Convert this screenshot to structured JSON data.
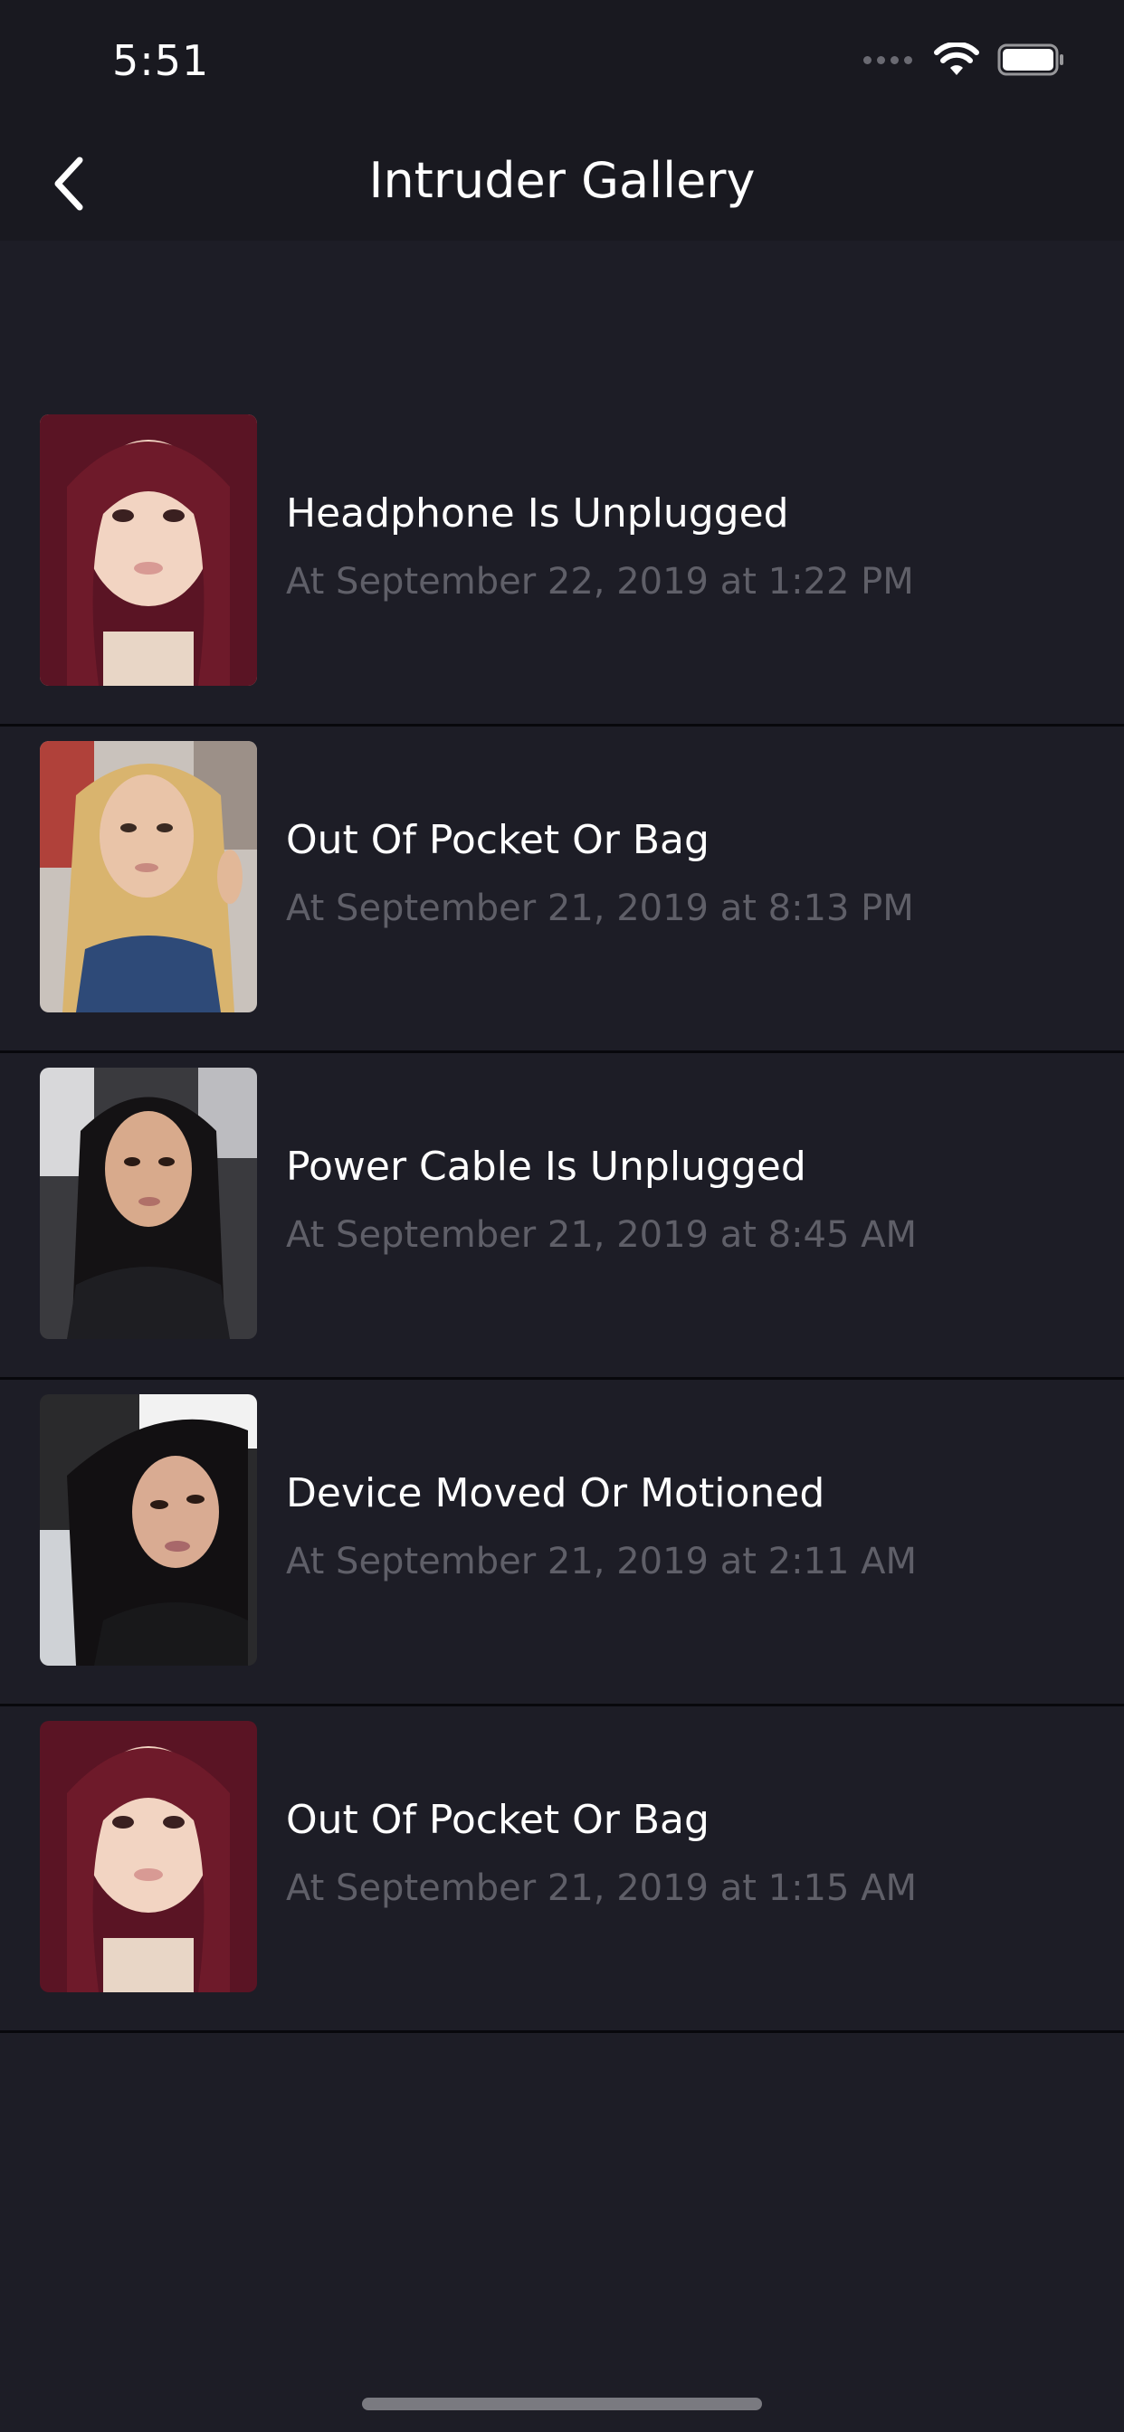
{
  "status_bar": {
    "time": "5:51",
    "icons": [
      "signal-dots-icon",
      "wifi-icon",
      "battery-icon"
    ]
  },
  "nav": {
    "back_icon": "chevron-left-icon",
    "title": "Intruder Gallery"
  },
  "items": [
    {
      "title": "Headphone Is Unplugged",
      "date": "At September 22, 2019 at 1:22 PM",
      "photo": "portrait-photo"
    },
    {
      "title": "Out Of Pocket Or Bag",
      "date": "At September 21, 2019 at 8:13 PM",
      "photo": "portrait-photo"
    },
    {
      "title": "Power Cable Is Unplugged",
      "date": "At September 21, 2019 at 8:45 AM",
      "photo": "portrait-photo"
    },
    {
      "title": "Device Moved Or Motioned",
      "date": "At September 21, 2019 at 2:11 AM",
      "photo": "portrait-photo"
    },
    {
      "title": "Out Of Pocket Or Bag",
      "date": "At September 21, 2019 at 1:15 AM",
      "photo": "portrait-photo"
    }
  ],
  "colors": {
    "background": "#1d1d26",
    "bar_background": "#191920",
    "title_text": "#ffffff",
    "date_text": "#5f5f68",
    "divider": "#08080c"
  }
}
